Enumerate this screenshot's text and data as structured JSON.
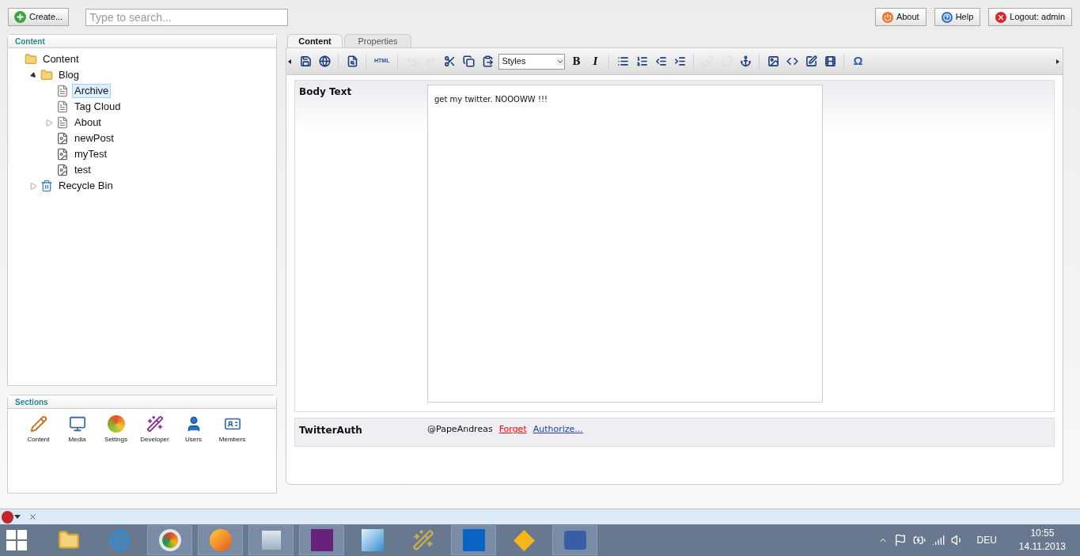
{
  "top_bar": {
    "create_button": {
      "label": "Create..."
    },
    "search": {
      "placeholder": "Type to search..."
    },
    "buttons": [
      {
        "kind": "about",
        "label": "About"
      },
      {
        "kind": "help",
        "label": "Help"
      },
      {
        "kind": "logout",
        "label": "Logout: admin"
      }
    ]
  },
  "content_panel": {
    "title": "Content",
    "tree": [
      {
        "label": "Content",
        "kind": "folder",
        "selected": false,
        "children": [
          {
            "label": "Blog",
            "kind": "folder",
            "selected": false,
            "expanded": true,
            "children": [
              {
                "label": "Archive",
                "kind": "document",
                "selected": true
              },
              {
                "label": "Tag Cloud",
                "kind": "document",
                "selected": false
              },
              {
                "label": "About",
                "kind": "document",
                "selected": false,
                "expanded": false
              },
              {
                "label": "newPost",
                "kind": "media",
                "selected": false
              },
              {
                "label": "myTest",
                "kind": "media",
                "selected": false
              },
              {
                "label": "test",
                "kind": "media",
                "selected": false
              }
            ]
          },
          {
            "label": "Recycle Bin",
            "kind": "recycle",
            "selected": false,
            "expanded": false
          }
        ]
      }
    ]
  },
  "sections_panel": {
    "title": "Sections",
    "items": [
      {
        "kind": "content",
        "label": "Content"
      },
      {
        "kind": "media",
        "label": "Media"
      },
      {
        "kind": "settings",
        "label": "Settings"
      },
      {
        "kind": "developer",
        "label": "Developer"
      },
      {
        "kind": "users",
        "label": "Users"
      },
      {
        "kind": "members",
        "label": "Members"
      }
    ]
  },
  "editor": {
    "tabs": [
      {
        "label": "Content",
        "selected": true
      },
      {
        "label": "Properties",
        "selected": false
      }
    ],
    "toolbar": [
      {
        "kind": "save",
        "disabled": false
      },
      {
        "kind": "save-publish",
        "disabled": false
      },
      {
        "kind": "separator"
      },
      {
        "kind": "preview",
        "disabled": false
      },
      {
        "kind": "separator"
      },
      {
        "kind": "text",
        "label": "HTML",
        "disabled": false
      },
      {
        "kind": "separator"
      },
      {
        "kind": "undo",
        "disabled": true
      },
      {
        "kind": "redo",
        "disabled": true
      },
      {
        "kind": "cut",
        "disabled": false
      },
      {
        "kind": "copy",
        "disabled": false
      },
      {
        "kind": "paste",
        "disabled": false
      },
      {
        "kind": "dropdown",
        "label": "Styles"
      },
      {
        "kind": "bold",
        "label": "B",
        "disabled": false
      },
      {
        "kind": "italic",
        "label": "I",
        "disabled": false
      },
      {
        "kind": "separator"
      },
      {
        "kind": "bullets",
        "disabled": false
      },
      {
        "kind": "numbers",
        "disabled": false
      },
      {
        "kind": "outdent",
        "disabled": false
      },
      {
        "kind": "indent",
        "disabled": false
      },
      {
        "kind": "separator"
      },
      {
        "kind": "link",
        "disabled": true
      },
      {
        "kind": "unlink",
        "disabled": true
      },
      {
        "kind": "anchor",
        "disabled": false
      },
      {
        "kind": "separator"
      },
      {
        "kind": "image",
        "disabled": false
      },
      {
        "kind": "macro",
        "disabled": false
      },
      {
        "kind": "form",
        "disabled": false
      },
      {
        "kind": "film",
        "disabled": false
      },
      {
        "kind": "separator"
      },
      {
        "kind": "symbol",
        "label": "Ω",
        "disabled": false
      }
    ],
    "body_text": {
      "label": "Body Text",
      "value": "get my twitter. NOOOWW !!!"
    },
    "twitter_auth": {
      "label": "TwitterAuth",
      "handle": "@PapeAndreas",
      "links": [
        {
          "label": "Forget",
          "color": "#ff0000"
        },
        {
          "label": "Authorize...",
          "color": "#1a3fa8"
        }
      ]
    }
  },
  "taskbar": {
    "tray": {
      "language": "DEU",
      "time": "10:55",
      "date": "14.11.2013"
    }
  }
}
